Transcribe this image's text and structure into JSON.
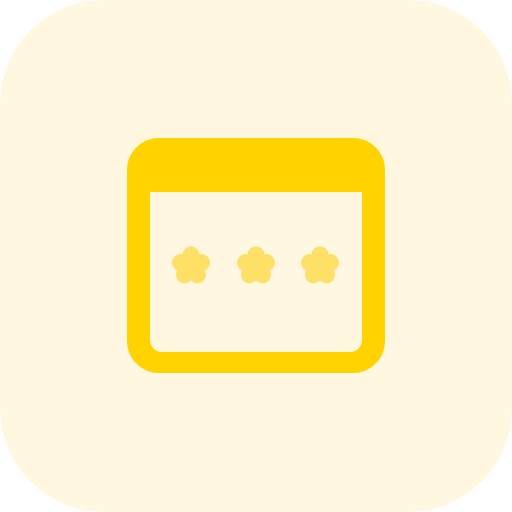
{
  "icon": {
    "name": "password-window-icon",
    "colors": {
      "background": "#fff7df",
      "frame": "#ffd200",
      "stars": "#ffe066"
    },
    "star_count": 3
  }
}
